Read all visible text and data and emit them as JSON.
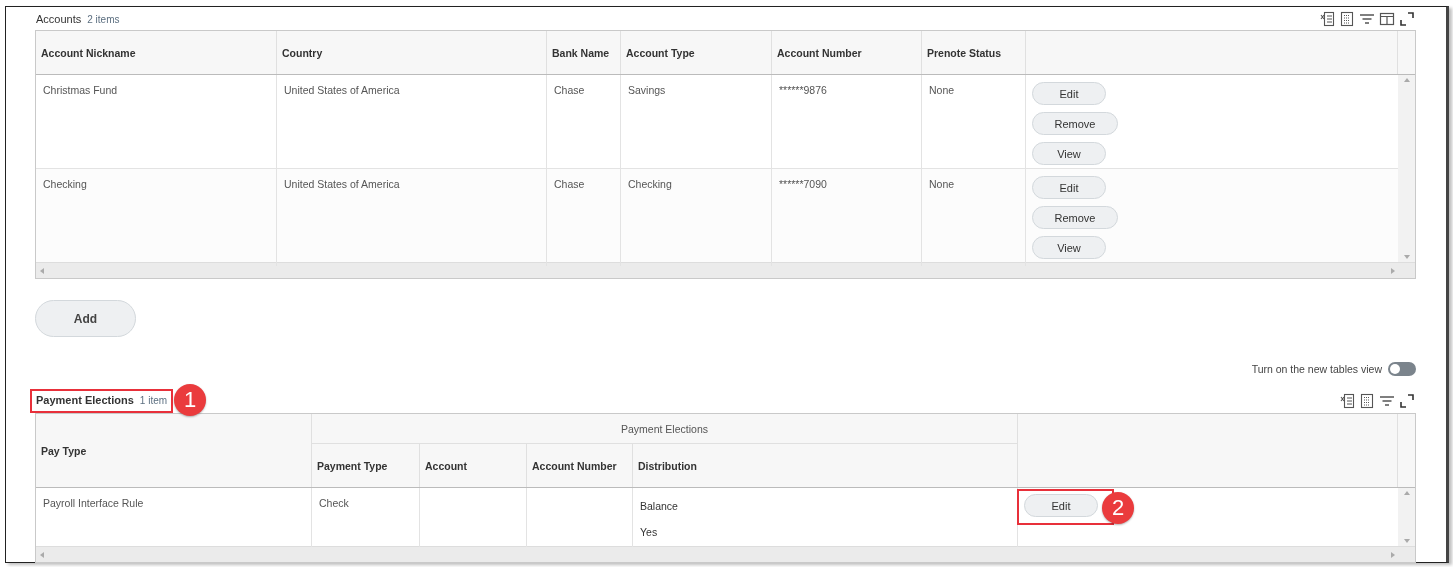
{
  "accounts": {
    "title": "Accounts",
    "count": "2 items",
    "columns": [
      "Account Nickname",
      "Country",
      "Bank Name",
      "Account Type",
      "Account Number",
      "Prenote Status"
    ],
    "rows": [
      {
        "cells": [
          "Christmas Fund",
          "United States of America",
          "Chase",
          "Savings",
          "******9876",
          "None"
        ],
        "actions": [
          "Edit",
          "Remove",
          "View"
        ]
      },
      {
        "cells": [
          "Checking",
          "United States of America",
          "Chase",
          "Checking",
          "******7090",
          "None"
        ],
        "actions": [
          "Edit",
          "Remove",
          "View"
        ]
      }
    ]
  },
  "add_button": "Add",
  "tables_view_toggle": {
    "label": "Turn on the new tables view",
    "on": false
  },
  "payment_elections": {
    "title": "Payment Elections",
    "count": "1 item",
    "callout": "1",
    "pay_type_header": "Pay Type",
    "group_header": "Payment Elections",
    "sub_columns": [
      "Payment Type",
      "Account",
      "Account Number",
      "Distribution"
    ],
    "rows": [
      {
        "pay_type": "Payroll Interface Rule",
        "payment_type": "Check",
        "distribution": [
          "Balance",
          "Yes"
        ],
        "action": "Edit",
        "action_callout": "2"
      }
    ]
  }
}
